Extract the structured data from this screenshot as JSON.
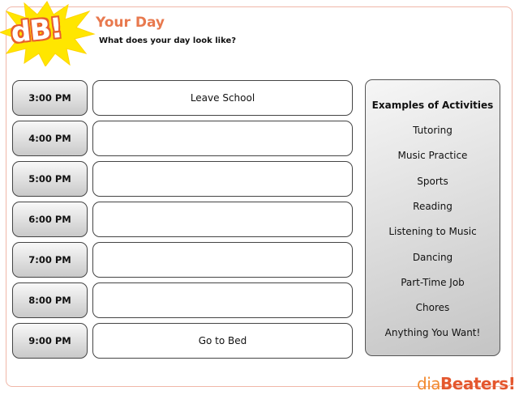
{
  "brand": {
    "logo_text": "dB!",
    "footer_part1": "dia",
    "footer_part2": "Beaters!"
  },
  "header": {
    "title": "Your Day",
    "subtitle": "What does your day look like?"
  },
  "schedule": [
    {
      "time": "3:00 PM",
      "activity": "Leave School"
    },
    {
      "time": "4:00 PM",
      "activity": ""
    },
    {
      "time": "5:00 PM",
      "activity": ""
    },
    {
      "time": "6:00 PM",
      "activity": ""
    },
    {
      "time": "7:00 PM",
      "activity": ""
    },
    {
      "time": "8:00 PM",
      "activity": ""
    },
    {
      "time": "9:00 PM",
      "activity": "Go to Bed"
    }
  ],
  "examples": {
    "title": "Examples of Activities",
    "items": [
      "Tutoring",
      "Music Practice",
      "Sports",
      "Reading",
      "Listening to Music",
      "Dancing",
      "Part-Time Job",
      "Chores",
      "Anything You Want!"
    ]
  },
  "colors": {
    "title": "#e8794e",
    "logo_burst": "#ffe600",
    "logo_text_outline": "#e8602c",
    "frame": "#f0b7a8"
  }
}
